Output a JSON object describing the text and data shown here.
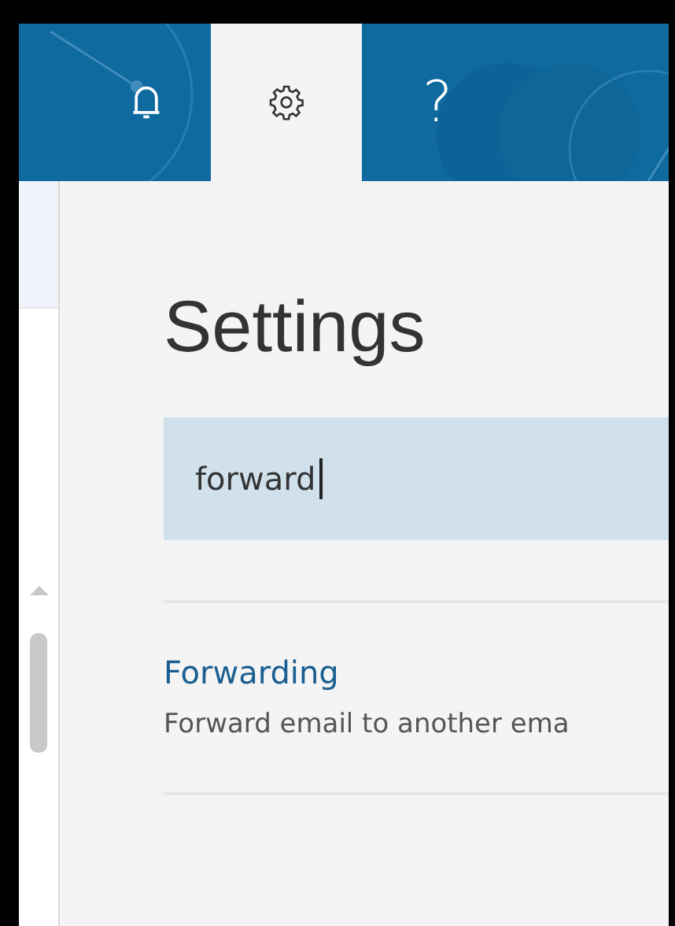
{
  "tabs": [
    {
      "kind": "bell",
      "selected": false
    },
    {
      "kind": "gear",
      "selected": true
    },
    {
      "kind": "glyph",
      "label": "?",
      "selected": false
    }
  ],
  "settings": {
    "title": "Settings",
    "search": {
      "value": "forward",
      "focused": true
    },
    "results": [
      {
        "title": "Forwarding",
        "description": "Forward email to another ema"
      }
    ]
  }
}
